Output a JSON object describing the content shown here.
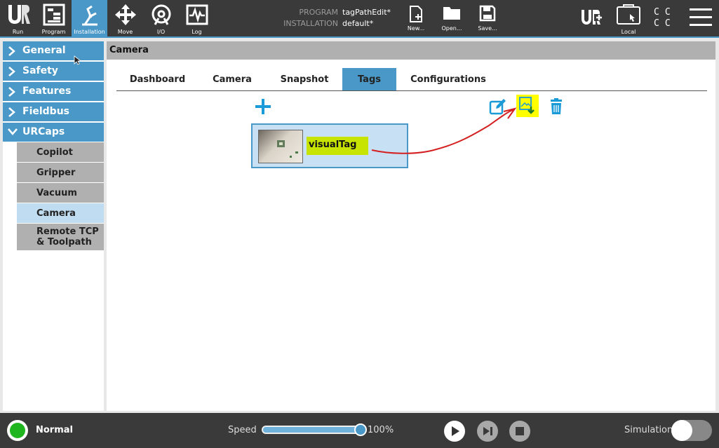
{
  "topbar": {
    "nav": [
      {
        "label": "Run",
        "icon": "ur-logo-icon"
      },
      {
        "label": "Program",
        "icon": "program-icon"
      },
      {
        "label": "Installation",
        "icon": "installation-icon",
        "active": true
      },
      {
        "label": "Move",
        "icon": "move-icon"
      },
      {
        "label": "I/O",
        "icon": "io-icon"
      },
      {
        "label": "Log",
        "icon": "log-icon"
      }
    ],
    "program_key": "PROGRAM",
    "program_value": "tagPathEdit*",
    "installation_key": "INSTALLATION",
    "installation_value": "default*",
    "file_buttons": [
      {
        "label": "New...",
        "icon": "new-file-icon"
      },
      {
        "label": "Open...",
        "icon": "open-folder-icon"
      },
      {
        "label": "Save...",
        "icon": "save-icon"
      }
    ],
    "local_label": "Local",
    "cc_text": "C C C C"
  },
  "sidebar": {
    "categories": [
      {
        "label": "General"
      },
      {
        "label": "Safety"
      },
      {
        "label": "Features"
      },
      {
        "label": "Fieldbus"
      },
      {
        "label": "URCaps",
        "expanded": true
      }
    ],
    "urcaps_items": [
      {
        "label": "Copilot"
      },
      {
        "label": "Gripper"
      },
      {
        "label": "Vacuum"
      },
      {
        "label": "Camera",
        "active": true
      },
      {
        "label": "Remote TCP & Toolpath"
      }
    ]
  },
  "main": {
    "header": "Camera",
    "tabs": [
      {
        "label": "Dashboard"
      },
      {
        "label": "Camera"
      },
      {
        "label": "Snapshot"
      },
      {
        "label": "Tags",
        "active": true
      },
      {
        "label": "Configurations"
      }
    ],
    "tags": [
      {
        "name": "visualTag"
      }
    ]
  },
  "bottombar": {
    "status": "Normal",
    "speed_label": "Speed",
    "speed_value": "100%",
    "speed_percent": 100,
    "simulation_label": "Simulation",
    "simulation_on": false
  },
  "colors": {
    "accent": "#4a98c8",
    "topbar": "#3a3a3a",
    "highlight": "#ffff00",
    "tag_highlight": "#c6e400",
    "annotation_arrow": "#d42020",
    "status_green": "#1fb51f"
  }
}
